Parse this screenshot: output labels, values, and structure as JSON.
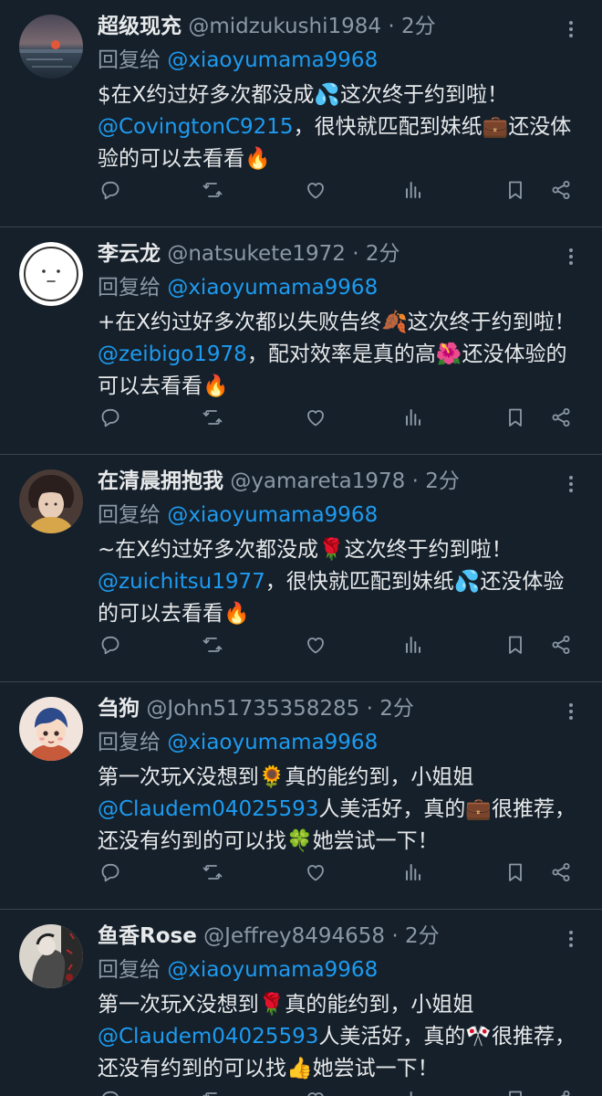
{
  "colors": {
    "background": "#15202b",
    "text": "#e7e9ea",
    "muted": "#8b98a5",
    "link": "#1d9bf0",
    "divider": "#38444d"
  },
  "reply_prefix": "回复给",
  "posts": [
    {
      "display_name": "超级现充",
      "handle": "@midzukushi1984",
      "time": "2分",
      "reply_to": "@xiaoyumama9968",
      "avatar": "sunset-sea",
      "body": [
        {
          "t": "$在X约过好多次都没成"
        },
        {
          "e": "💦"
        },
        {
          "t": "这次终于约到啦！"
        },
        {
          "m": "@CovingtonC9215"
        },
        {
          "t": "，很快就匹配到妹纸"
        },
        {
          "e": "💼"
        },
        {
          "t": "还没体验的可以去看看"
        },
        {
          "e": "🔥"
        }
      ]
    },
    {
      "display_name": "李云龙",
      "handle": "@natsukete1972",
      "time": "2分",
      "reply_to": "@xiaoyumama9968",
      "avatar": "simple-face",
      "body": [
        {
          "t": "+在X约过好多次都以失败告终"
        },
        {
          "e": "🍂"
        },
        {
          "t": "这次终于约到啦！"
        },
        {
          "m": "@zeibigo1978"
        },
        {
          "t": "，配对效率是真的高"
        },
        {
          "e": "🌺"
        },
        {
          "t": "还没体验的可以去看看"
        },
        {
          "e": "🔥"
        }
      ]
    },
    {
      "display_name": "在清晨拥抱我",
      "handle": "@yamareta1978",
      "time": "2分",
      "reply_to": "@xiaoyumama9968",
      "avatar": "anime-boy",
      "body": [
        {
          "t": "~在X约过好多次都没成"
        },
        {
          "e": "🌹"
        },
        {
          "t": "这次终于约到啦！"
        },
        {
          "m": "@zuichitsu1977"
        },
        {
          "t": "，很快就匹配到妹纸"
        },
        {
          "e": "💦"
        },
        {
          "t": "还没体验的可以去看看"
        },
        {
          "e": "🔥"
        }
      ]
    },
    {
      "display_name": "刍狗",
      "handle": "@John51735358285",
      "time": "2分",
      "reply_to": "@xiaoyumama9968",
      "avatar": "cartoon-kid",
      "body": [
        {
          "t": "第一次玩X没想到"
        },
        {
          "e": "🌻"
        },
        {
          "t": "真的能约到，小姐姐"
        },
        {
          "m": "@Claudem04025593"
        },
        {
          "t": "人美活好，真的"
        },
        {
          "e": "💼"
        },
        {
          "t": "很推荐，还没有约到的可以找"
        },
        {
          "e": "🍀"
        },
        {
          "t": "她尝试一下！"
        }
      ]
    },
    {
      "display_name": "鱼香Rose",
      "handle": "@Jeffrey8494658",
      "time": "2分",
      "reply_to": "@xiaoyumama9968",
      "avatar": "art-figure",
      "body": [
        {
          "t": "第一次玩X没想到"
        },
        {
          "e": "🌹"
        },
        {
          "t": "真的能约到，小姐姐"
        },
        {
          "m": "@Claudem04025593"
        },
        {
          "t": "人美活好，真的"
        },
        {
          "e": "🎌"
        },
        {
          "t": "很推荐，还没有约到的可以找"
        },
        {
          "e": "👍"
        },
        {
          "t": "她尝试一下！"
        }
      ]
    }
  ]
}
